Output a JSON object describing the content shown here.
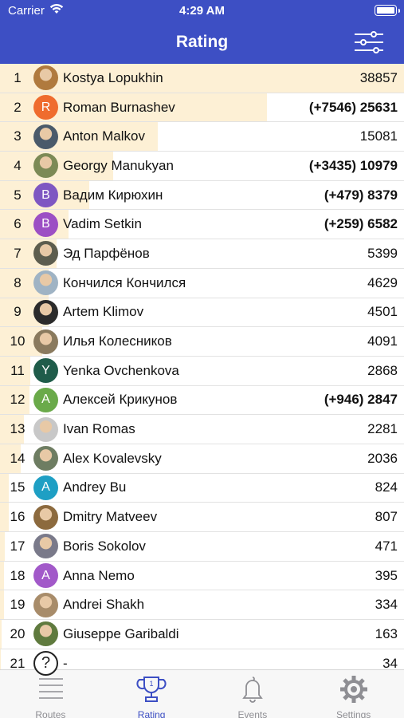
{
  "status": {
    "carrier": "Carrier",
    "time": "4:29 AM"
  },
  "header": {
    "title": "Rating"
  },
  "colors": {
    "brand": "#3d4fc4",
    "bar": "#fdf0d5",
    "inactive_tab": "#8e8e93"
  },
  "rows": [
    {
      "rank": "1",
      "name": "Kostya Lopukhin",
      "score": "38857",
      "bold": false,
      "avatar": {
        "type": "photo",
        "color": "#b07a3e",
        "letter": ""
      },
      "fraction": 1.0
    },
    {
      "rank": "2",
      "name": "Roman Burnashev",
      "score": "(+7546) 25631",
      "bold": true,
      "avatar": {
        "type": "letter",
        "color": "#ef6c2e",
        "letter": "R"
      },
      "fraction": 0.66
    },
    {
      "rank": "3",
      "name": "Anton Malkov",
      "score": "15081",
      "bold": false,
      "avatar": {
        "type": "photo",
        "color": "#4a5a6a",
        "letter": ""
      },
      "fraction": 0.39
    },
    {
      "rank": "4",
      "name": "Georgy Manukyan",
      "score": "(+3435) 10979",
      "bold": true,
      "avatar": {
        "type": "photo",
        "color": "#7c8a56",
        "letter": ""
      },
      "fraction": 0.28
    },
    {
      "rank": "5",
      "name": "Вадим Кирюхин",
      "score": "(+479) 8379",
      "bold": true,
      "avatar": {
        "type": "letter",
        "color": "#7e57c2",
        "letter": "В"
      },
      "fraction": 0.22
    },
    {
      "rank": "6",
      "name": "Vadim Setkin",
      "score": "(+259) 6582",
      "bold": true,
      "avatar": {
        "type": "letter",
        "color": "#9c4fc4",
        "letter": "В"
      },
      "fraction": 0.17
    },
    {
      "rank": "7",
      "name": "Эд Парфёнов",
      "score": "5399",
      "bold": false,
      "avatar": {
        "type": "photo",
        "color": "#5d5d4e",
        "letter": ""
      },
      "fraction": 0.14
    },
    {
      "rank": "8",
      "name": "Кончился Кончился",
      "score": "4629",
      "bold": false,
      "avatar": {
        "type": "photo",
        "color": "#9fb3c4",
        "letter": ""
      },
      "fraction": 0.12
    },
    {
      "rank": "9",
      "name": "Artem Klimov",
      "score": "4501",
      "bold": false,
      "avatar": {
        "type": "photo",
        "color": "#2b2b2b",
        "letter": ""
      },
      "fraction": 0.12
    },
    {
      "rank": "10",
      "name": "Илья Колесников",
      "score": "4091",
      "bold": false,
      "avatar": {
        "type": "photo",
        "color": "#8a7a5e",
        "letter": ""
      },
      "fraction": 0.105
    },
    {
      "rank": "11",
      "name": "Yenka Ovchenkova",
      "score": "2868",
      "bold": false,
      "avatar": {
        "type": "letter",
        "color": "#1f5c4a",
        "letter": "Y"
      },
      "fraction": 0.074
    },
    {
      "rank": "12",
      "name": "Алексей Крикунов",
      "score": "(+946) 2847",
      "bold": true,
      "avatar": {
        "type": "letter",
        "color": "#6aaa4a",
        "letter": "А"
      },
      "fraction": 0.073
    },
    {
      "rank": "13",
      "name": "Ivan Romas",
      "score": "2281",
      "bold": false,
      "avatar": {
        "type": "photo",
        "color": "#c8c8c8",
        "letter": ""
      },
      "fraction": 0.059
    },
    {
      "rank": "14",
      "name": "Alex Kovalevsky",
      "score": "2036",
      "bold": false,
      "avatar": {
        "type": "photo",
        "color": "#6e7d62",
        "letter": ""
      },
      "fraction": 0.052
    },
    {
      "rank": "15",
      "name": "Andrey Bu",
      "score": "824",
      "bold": false,
      "avatar": {
        "type": "letter",
        "color": "#1e9fc4",
        "letter": "A"
      },
      "fraction": 0.021
    },
    {
      "rank": "16",
      "name": "Dmitry Matveev",
      "score": "807",
      "bold": false,
      "avatar": {
        "type": "photo",
        "color": "#8c6a3e",
        "letter": ""
      },
      "fraction": 0.021
    },
    {
      "rank": "17",
      "name": "Boris Sokolov",
      "score": "471",
      "bold": false,
      "avatar": {
        "type": "photo",
        "color": "#7a7a8a",
        "letter": ""
      },
      "fraction": 0.012
    },
    {
      "rank": "18",
      "name": "Anna Nemo",
      "score": "395",
      "bold": false,
      "avatar": {
        "type": "letter",
        "color": "#a259c9",
        "letter": "A"
      },
      "fraction": 0.01
    },
    {
      "rank": "19",
      "name": "Andrei Shakh",
      "score": "334",
      "bold": false,
      "avatar": {
        "type": "photo",
        "color": "#a88c6a",
        "letter": ""
      },
      "fraction": 0.009
    },
    {
      "rank": "20",
      "name": "Giuseppe Garibaldi",
      "score": "163",
      "bold": false,
      "avatar": {
        "type": "photo",
        "color": "#5f7a3e",
        "letter": ""
      },
      "fraction": 0.004
    },
    {
      "rank": "21",
      "name": "-",
      "score": "34",
      "bold": false,
      "avatar": {
        "type": "unknown",
        "color": "#ffffff",
        "letter": "?"
      },
      "fraction": 0.001
    }
  ],
  "tabs": [
    {
      "label": "Routes",
      "icon": "routes-list-icon",
      "active": false
    },
    {
      "label": "Rating",
      "icon": "trophy-icon",
      "active": true
    },
    {
      "label": "Events",
      "icon": "bell-icon",
      "active": false
    },
    {
      "label": "Settings",
      "icon": "gear-icon",
      "active": false
    }
  ]
}
